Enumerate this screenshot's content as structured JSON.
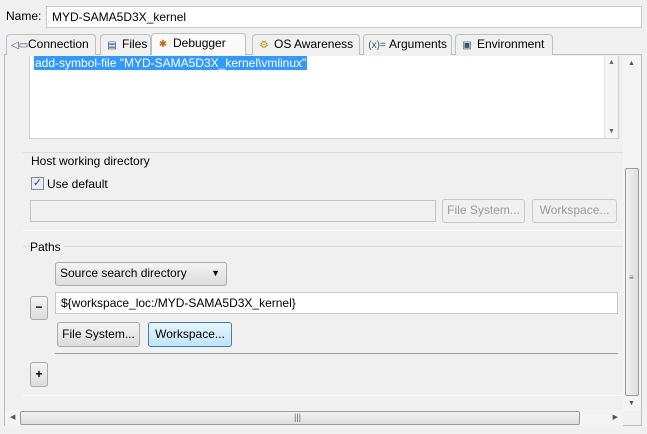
{
  "name_label": "Name:",
  "name_value": "MYD-SAMA5D3X_kernel",
  "tabs": [
    {
      "label": "Connection",
      "icon": "connection-icon"
    },
    {
      "label": "Files",
      "icon": "files-icon"
    },
    {
      "label": "Debugger",
      "icon": "bug-icon"
    },
    {
      "label": "OS Awareness",
      "icon": "gears-icon"
    },
    {
      "label": "Arguments",
      "icon": "arguments-icon"
    },
    {
      "label": "Environment",
      "icon": "environment-icon"
    }
  ],
  "commands_text": "add-symbol-file \"MYD-SAMA5D3X_kernel\\vmlinux\"",
  "host": {
    "title": "Host working directory",
    "use_default_label": "Use default",
    "use_default": true,
    "value": "",
    "file_system": "File System...",
    "workspace": "Workspace..."
  },
  "paths": {
    "title": "Paths",
    "type": "Source search directory",
    "value": "${workspace_loc:/MYD-SAMA5D3X_kernel}",
    "file_system": "File System...",
    "workspace": "Workspace...",
    "remove": "−",
    "add": "+"
  }
}
